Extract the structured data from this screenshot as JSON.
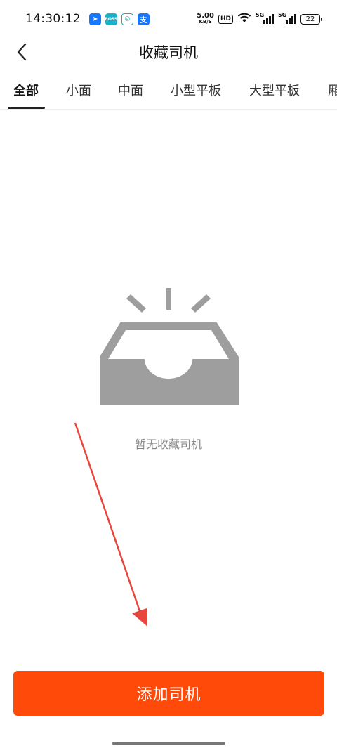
{
  "status_bar": {
    "time": "14:30:12",
    "apps": [
      {
        "icon": "paper-plane-app-icon",
        "glyph": "➤"
      },
      {
        "icon": "boss-zhipin-app-icon",
        "glyph": "BOSS"
      },
      {
        "icon": "china-mobile-app-icon",
        "glyph": "◎"
      },
      {
        "icon": "alipay-app-icon",
        "glyph": "支"
      }
    ],
    "net_speed_value": "5.00",
    "net_speed_unit": "KB/S",
    "hd_label": "HD",
    "signal1_label": "5G",
    "signal2_label": "5G",
    "battery": "22"
  },
  "header": {
    "back_icon": "chevron-left-icon",
    "title": "收藏司机"
  },
  "tabs": [
    {
      "label": "全部",
      "active": true
    },
    {
      "label": "小面",
      "active": false
    },
    {
      "label": "中面",
      "active": false
    },
    {
      "label": "小型平板",
      "active": false
    },
    {
      "label": "大型平板",
      "active": false
    },
    {
      "label": "厢",
      "active": false
    }
  ],
  "empty_state": {
    "icon": "empty-inbox-icon",
    "message": "暂无收藏司机",
    "icon_color": "#9e9e9e"
  },
  "annotation": {
    "icon": "red-arrow-annotation",
    "color": "#e8453c"
  },
  "footer": {
    "add_button_label": "添加司机",
    "button_color": "#ff4a0a"
  }
}
